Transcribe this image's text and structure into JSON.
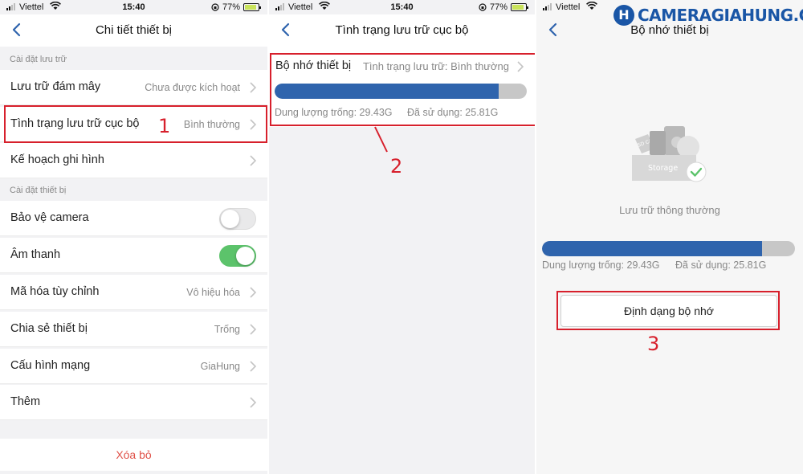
{
  "watermark": {
    "logo_letter": "H",
    "text": "CAMERAGIAHUNG.COM"
  },
  "colors": {
    "accent_blue": "#2f64ad",
    "annotation_red": "#d7202c",
    "toggle_on": "#5cc36b",
    "delete_red": "#e0534a"
  },
  "screen1": {
    "status": {
      "carrier": "Viettel",
      "time": "15:40",
      "battery": "77%"
    },
    "title": "Chi tiết thiết bị",
    "sections": [
      {
        "header": "Cài đặt lưu trữ",
        "rows": [
          {
            "label": "Lưu trữ đám mây",
            "value": "Chưa được kích hoạt"
          },
          {
            "label": "Tình trạng lưu trữ cục bộ",
            "value": "Bình thường"
          },
          {
            "label": "Kế hoạch ghi hình",
            "value": ""
          }
        ]
      },
      {
        "header": "Cài đặt thiết bị",
        "rows": [
          {
            "label": "Bảo vệ camera",
            "toggle": false
          },
          {
            "label": "Âm thanh",
            "toggle": true
          },
          {
            "label": "Mã hóa tùy chỉnh",
            "value": "Vô hiệu hóa"
          },
          {
            "label": "Chia sẻ thiết bị",
            "value": "Trống"
          },
          {
            "label": "Cấu hình mạng",
            "value": "GiaHung"
          },
          {
            "label": "Thêm",
            "value": ""
          }
        ]
      }
    ],
    "delete_label": "Xóa bỏ",
    "step_marker": "1"
  },
  "screen2": {
    "status": {
      "carrier": "Viettel",
      "time": "15:40",
      "battery": "77%"
    },
    "title": "Tình trạng lưu trữ cục bộ",
    "card": {
      "label": "Bộ nhớ thiết bị",
      "status": "Tình trạng lưu trữ: Bình thường",
      "used_fraction": 0.89,
      "free_text": "Dung lượng trống: 29.43G",
      "used_text": "Đã sử dụng: 25.81G"
    },
    "step_marker": "2"
  },
  "screen3": {
    "status": {
      "carrier": "Viettel"
    },
    "title": "Bộ nhớ thiết bị",
    "illustration": {
      "sd_label": "SD CARD",
      "box_label": "Storage"
    },
    "status_text": "Lưu trữ thông thường",
    "used_fraction": 0.87,
    "free_text": "Dung lượng trống: 29.43G",
    "used_text": "Đã sử dụng: 25.81G",
    "format_button": "Định dạng bộ nhớ",
    "step_marker": "3"
  }
}
